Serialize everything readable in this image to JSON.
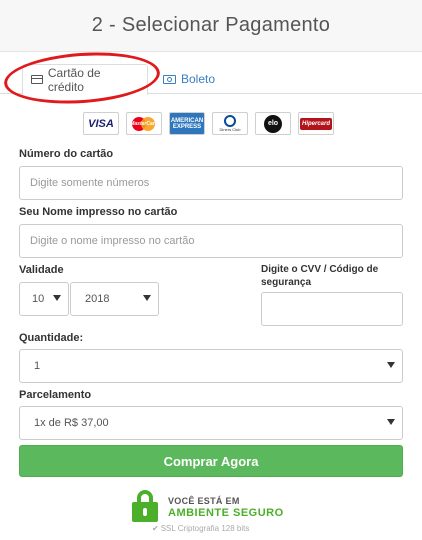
{
  "header": {
    "title": "2 - Selecionar Pagamento"
  },
  "tabs": [
    {
      "label": "Cartão de crédito",
      "icon": "credit-card-icon",
      "active": true
    },
    {
      "label": "Boleto",
      "icon": "money-icon",
      "active": false
    }
  ],
  "brands": {
    "visa": "VISA",
    "mastercard": "MasterCard",
    "amex": "AMERICAN EXPRESS",
    "diners": "Diners Club",
    "elo": "elo",
    "hipercard": "Hipercard"
  },
  "form": {
    "card_number": {
      "label": "Número do cartão",
      "placeholder": "Digite somente números"
    },
    "name": {
      "label": "Seu Nome impresso no cartão",
      "placeholder": "Digite o nome impresso no cartão"
    },
    "validity": {
      "label": "Validade",
      "month": "10",
      "year": "2018"
    },
    "cvv": {
      "label": "Digite o CVV / Código de segurança",
      "value": ""
    },
    "quantity": {
      "label": "Quantidade:",
      "value": "1"
    },
    "installments": {
      "label": "Parcelamento",
      "value": "1x de R$ 37,00"
    }
  },
  "buy_button": {
    "label": "Comprar Agora"
  },
  "secure": {
    "line1": "VOCÊ ESTÁ EM",
    "line2": "AMBIENTE SEGURO",
    "line3": "SSL Criptografia 128 bits"
  },
  "colors": {
    "primary_button": "#5cb85c",
    "link": "#3a7fc1",
    "highlight_ring": "#e0191b",
    "secure_green": "#4caf29"
  }
}
